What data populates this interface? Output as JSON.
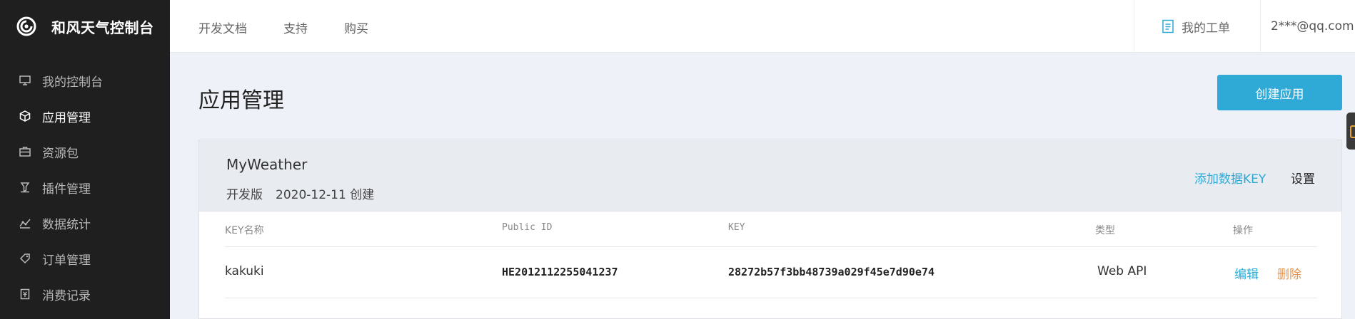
{
  "brand": {
    "name": "和风天气控制台",
    "logo_icon": "qweather-swirl-logo"
  },
  "sidebar": {
    "items": [
      {
        "label": "我的控制台",
        "icon": "monitor-icon",
        "active": false
      },
      {
        "label": "应用管理",
        "icon": "cube-icon",
        "active": true
      },
      {
        "label": "资源包",
        "icon": "briefcase-icon",
        "active": false
      },
      {
        "label": "插件管理",
        "icon": "plugin-icon",
        "active": false
      },
      {
        "label": "数据统计",
        "icon": "stats-icon",
        "active": false
      },
      {
        "label": "订单管理",
        "icon": "tag-icon",
        "active": false
      },
      {
        "label": "消费记录",
        "icon": "receipt-icon",
        "active": false
      }
    ]
  },
  "topbar": {
    "links": [
      "开发文档",
      "支持",
      "购买"
    ],
    "ticket_label": "我的工单",
    "user": "2***@qq.com"
  },
  "main": {
    "title": "应用管理",
    "create_button": "创建应用"
  },
  "app_card": {
    "name": "MyWeather",
    "edition": "开发版",
    "created": "2020-12-11 创建",
    "add_key_label": "添加数据KEY",
    "settings_label": "设置",
    "table": {
      "headers": [
        "KEY名称",
        "Public ID",
        "KEY",
        "类型",
        "操作"
      ],
      "rows": [
        {
          "name": "kakuki",
          "public_id": "HE2012112255041237",
          "key": "28272b57f3bb48739a029f45e7d90e74",
          "type": "Web API",
          "edit": "编辑",
          "delete": "删除"
        }
      ]
    }
  },
  "colors": {
    "accent": "#2fa9d6",
    "danger": "#e8944a",
    "sidebar_bg": "#1f1f1f"
  }
}
